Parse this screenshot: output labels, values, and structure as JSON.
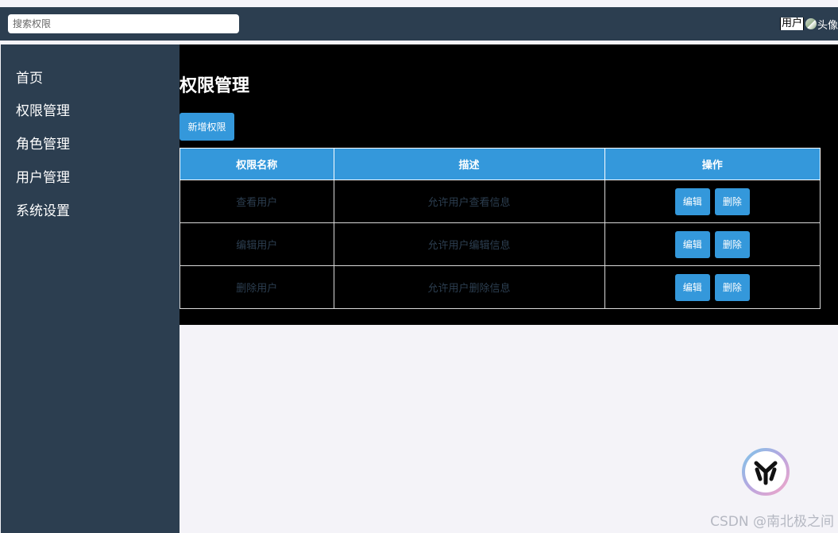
{
  "header": {
    "search_placeholder": "搜索权限",
    "user_label": "用户",
    "avatar_alt": "头像",
    "background_color": "#2c3e50"
  },
  "sidebar": {
    "items": [
      {
        "label": "首页"
      },
      {
        "label": "权限管理"
      },
      {
        "label": "角色管理"
      },
      {
        "label": "用户管理"
      },
      {
        "label": "系统设置"
      }
    ],
    "background_color": "#2c3e50"
  },
  "main": {
    "title": "权限管理",
    "add_button_label": "新增权限",
    "table": {
      "headers": [
        "权限名称",
        "描述",
        "操作"
      ],
      "rows": [
        {
          "name": "查看用户",
          "description": "允许用户查看信息",
          "edit_label": "编辑",
          "delete_label": "删除"
        },
        {
          "name": "编辑用户",
          "description": "允许用户编辑信息",
          "edit_label": "编辑",
          "delete_label": "删除"
        },
        {
          "name": "删除用户",
          "description": "允许用户删除信息",
          "edit_label": "编辑",
          "delete_label": "删除"
        }
      ]
    },
    "accent_color": "#3498db"
  },
  "watermark": {
    "text": "CSDN @南北极之间",
    "icon": "csdn-logo-icon"
  }
}
